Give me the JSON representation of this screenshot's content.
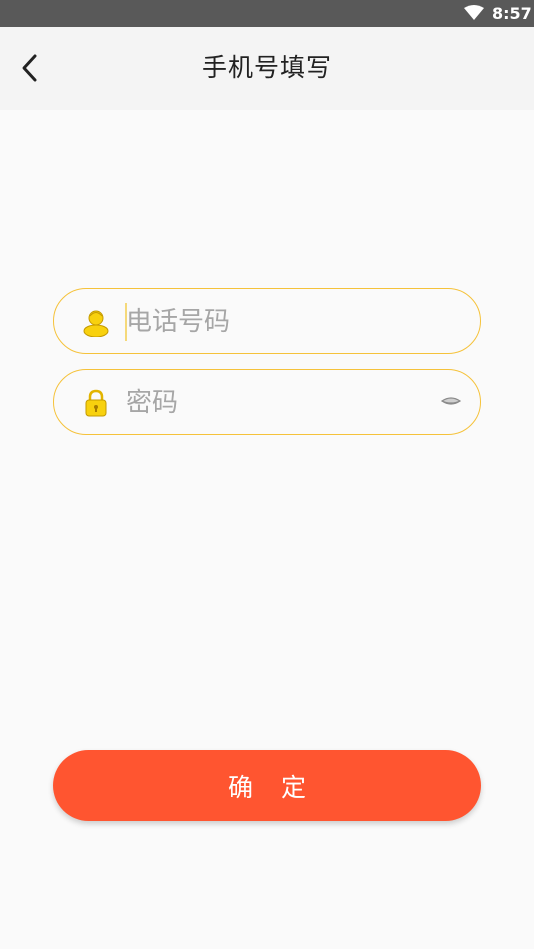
{
  "status_bar": {
    "time": "8:57",
    "wifi_icon": "wifi-icon",
    "background": "#595959"
  },
  "app_bar": {
    "title": "手机号填写",
    "back_icon": "chevron-left-icon"
  },
  "form": {
    "phone": {
      "placeholder": "电话号码",
      "icon": "user-icon"
    },
    "password": {
      "placeholder": "密码",
      "icon": "lock-icon",
      "toggle_icon": "eye-closed-icon"
    },
    "border_color": "#f5c23a"
  },
  "confirm_button": {
    "label": "确 定",
    "color": "#ff5530"
  }
}
